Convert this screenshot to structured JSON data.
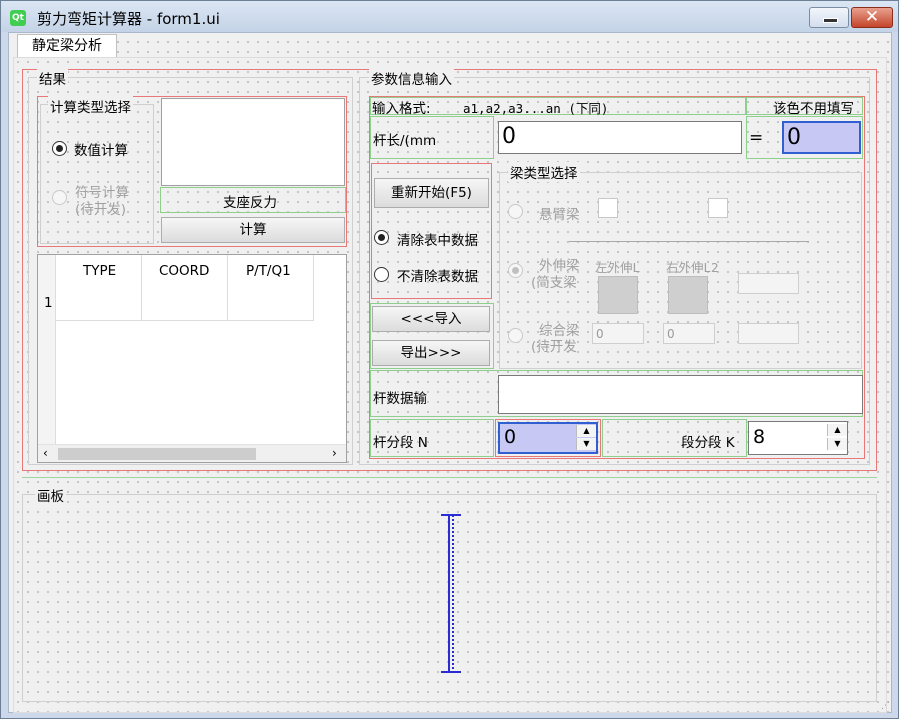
{
  "window": {
    "title": "剪力弯矩计算器 - form1.ui",
    "icon": "qt-icon"
  },
  "tab": {
    "label": "静定梁分析"
  },
  "result": {
    "group_title": "结果",
    "calc_type_title": "计算类型选择",
    "radio_numeric": "数值计算",
    "radio_symbolic_1": "符号计算",
    "radio_symbolic_2": "(待开发)",
    "support_label": "支座反力",
    "calc_button": "计算",
    "table": {
      "headers": [
        "TYPE",
        "COORD",
        "P/T/Q1"
      ],
      "row_labels": [
        "1"
      ]
    }
  },
  "params": {
    "group_title": "参数信息输入",
    "format_label": "输入格式:",
    "format_example": "a1,a2,a3...an (下同)",
    "hint_label": "该色不用填写",
    "length_label": "杆长/(mm",
    "length_value": "0",
    "equals": "=",
    "length_result": "0",
    "restart_button": "重新开始(F5)",
    "radio_clear": "清除表中数据",
    "radio_keep": "不清除表数据",
    "import_button": "<<<导入",
    "export_button": "导出>>>",
    "beam_type_title": "梁类型选择",
    "cantilever": "悬臂梁",
    "overhang_1": "外伸梁",
    "overhang_2": "(简支梁",
    "left_overhang": "左外伸L",
    "right_overhang": "右外伸L2",
    "combined_1": "综合梁",
    "combined_2": "(待开发",
    "combined_field_1": "0",
    "combined_field_2": "0",
    "bar_data_label": "杆数据输",
    "bar_segments_label": "杆分段 N",
    "bar_segments_value": "0",
    "seg_segments_label": "段分段 K",
    "seg_segments_value": "8"
  },
  "canvas": {
    "group_title": "画板"
  },
  "colors": {
    "highlight": "#c8c8f5",
    "beam": "#2b2bd6",
    "red_frame": "#e87878",
    "green_frame": "#8ecf8e"
  }
}
